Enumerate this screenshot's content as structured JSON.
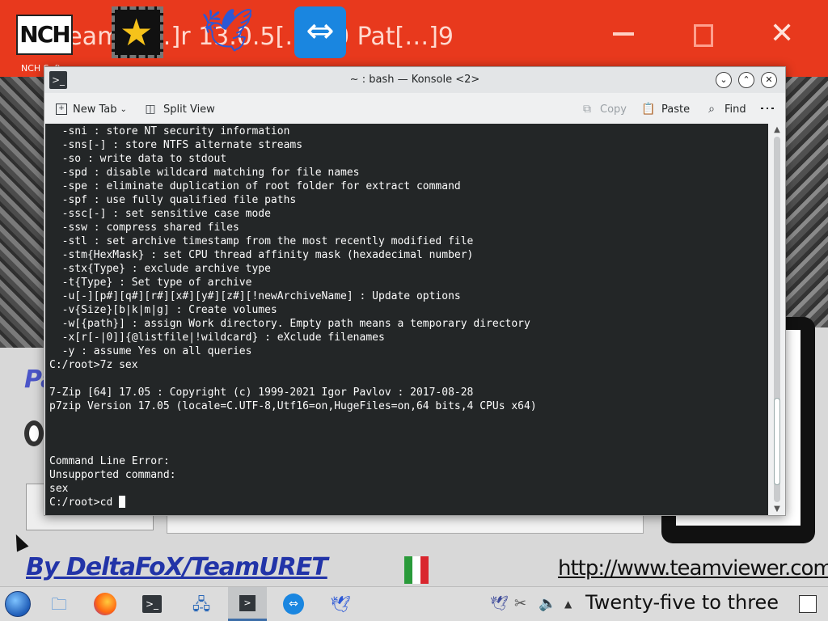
{
  "background_window": {
    "title": "TeamV[…]r 13.0.5[…]40 Pat[…]9",
    "subtitle": "NCH Software",
    "left_text": "Pa",
    "credit": "By DeltaFoX/TeamURET",
    "url": "http://www.teamviewer.com",
    "flag_colors": [
      "#2a9a3a",
      "#ffffff",
      "#d9262e"
    ]
  },
  "desktop_icons": [
    "nch-software-icon",
    "movie-star-icon",
    "bird-icon",
    "teamviewer-icon"
  ],
  "nch_label": "NCH",
  "konsole": {
    "title": "~ : bash — Konsole <2>",
    "toolbar": {
      "new_tab": "New Tab",
      "split_view": "Split View",
      "copy": "Copy",
      "paste": "Paste",
      "find": "Find"
    },
    "terminal_lines": [
      "  -sni : store NT security information",
      "  -sns[-] : store NTFS alternate streams",
      "  -so : write data to stdout",
      "  -spd : disable wildcard matching for file names",
      "  -spe : eliminate duplication of root folder for extract command",
      "  -spf : use fully qualified file paths",
      "  -ssc[-] : set sensitive case mode",
      "  -ssw : compress shared files",
      "  -stl : set archive timestamp from the most recently modified file",
      "  -stm{HexMask} : set CPU thread affinity mask (hexadecimal number)",
      "  -stx{Type} : exclude archive type",
      "  -t{Type} : Set type of archive",
      "  -u[-][p#][q#][r#][x#][y#][z#][!newArchiveName] : Update options",
      "  -v{Size}[b|k|m|g] : Create volumes",
      "  -w[{path}] : assign Work directory. Empty path means a temporary directory",
      "  -x[r[-|0]]{@listfile|!wildcard} : eXclude filenames",
      "  -y : assume Yes on all queries",
      "C:/root>7z sex",
      "",
      "7-Zip [64] 17.05 : Copyright (c) 1999-2021 Igor Pavlov : 2017-08-28",
      "p7zip Version 17.05 (locale=C.UTF-8,Utf16=on,HugeFiles=on,64 bits,4 CPUs x64)",
      "",
      "",
      "",
      "Command Line Error:",
      "Unsupported command:",
      "sex"
    ],
    "prompt_line": "C:/root>cd ",
    "scrollbar_position": 0.94,
    "scrollbar_visible_fraction": 0.24
  },
  "taskbar": {
    "clock": "Twenty-five to three",
    "items": [
      "start-menu",
      "file-manager",
      "firefox",
      "terminal",
      "network",
      "konsole",
      "teamviewer",
      "bird-app"
    ],
    "tray": [
      "bird-tray",
      "scissors",
      "volume",
      "expand"
    ]
  }
}
